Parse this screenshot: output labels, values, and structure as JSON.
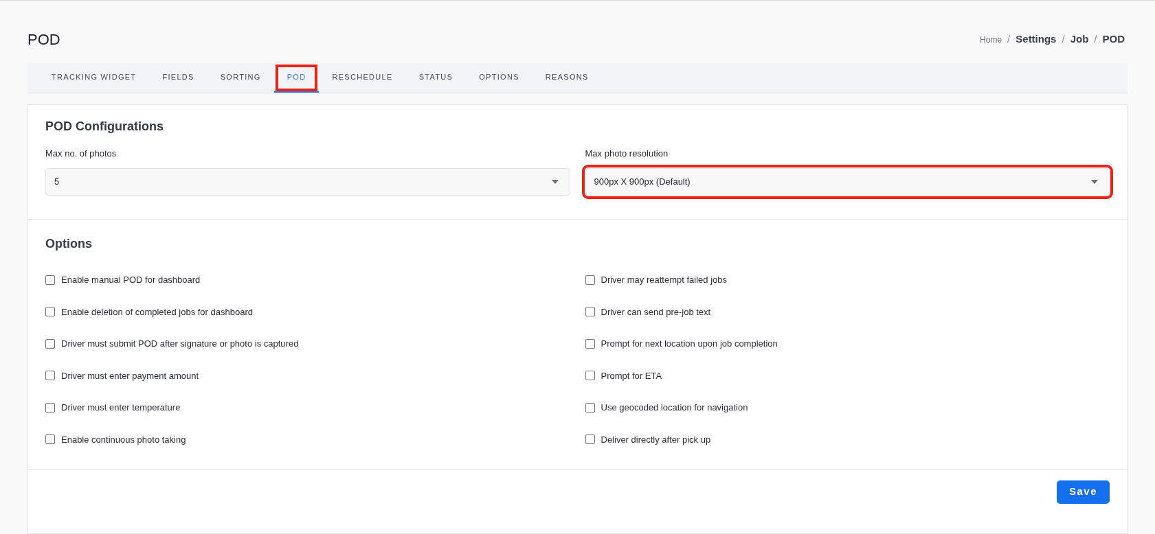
{
  "page_title": "POD",
  "breadcrumb": [
    {
      "label": "Home",
      "current": false
    },
    {
      "label": "Settings",
      "current": true
    },
    {
      "label": "Job",
      "current": true
    },
    {
      "label": "POD",
      "current": true
    }
  ],
  "breadcrumb_separator": "/",
  "tabs": [
    {
      "label": "TRACKING WIDGET",
      "selected": false,
      "highlighted": false
    },
    {
      "label": "FIELDS",
      "selected": false,
      "highlighted": false
    },
    {
      "label": "SORTING",
      "selected": false,
      "highlighted": false
    },
    {
      "label": "POD",
      "selected": true,
      "highlighted": true
    },
    {
      "label": "RESCHEDULE",
      "selected": false,
      "highlighted": false
    },
    {
      "label": "STATUS",
      "selected": false,
      "highlighted": false
    },
    {
      "label": "OPTIONS",
      "selected": false,
      "highlighted": false
    },
    {
      "label": "REASONS",
      "selected": false,
      "highlighted": false
    }
  ],
  "configurations": {
    "title": "POD Configurations",
    "fields": [
      {
        "label": "Max no. of photos",
        "value": "5",
        "highlighted": false
      },
      {
        "label": "Max photo resolution",
        "value": "900px X 900px (Default)",
        "highlighted": true
      }
    ]
  },
  "options": {
    "title": "Options",
    "columns": [
      [
        {
          "label": "Enable manual POD for dashboard",
          "checked": false
        },
        {
          "label": "Enable deletion of completed jobs for dashboard",
          "checked": false
        },
        {
          "label": "Driver must submit POD after signature or photo is captured",
          "checked": false
        },
        {
          "label": "Driver must enter payment amount",
          "checked": false
        },
        {
          "label": "Driver must enter temperature",
          "checked": false
        },
        {
          "label": "Enable continuous photo taking",
          "checked": false
        }
      ],
      [
        {
          "label": "Driver may reattempt failed jobs",
          "checked": false
        },
        {
          "label": "Driver can send pre-job text",
          "checked": false
        },
        {
          "label": "Prompt for next location upon job completion",
          "checked": false
        },
        {
          "label": "Prompt for ETA",
          "checked": false
        },
        {
          "label": "Use geocoded location for navigation",
          "checked": false
        },
        {
          "label": "Deliver directly after pick up",
          "checked": false
        }
      ]
    ]
  },
  "save_button": "Save"
}
